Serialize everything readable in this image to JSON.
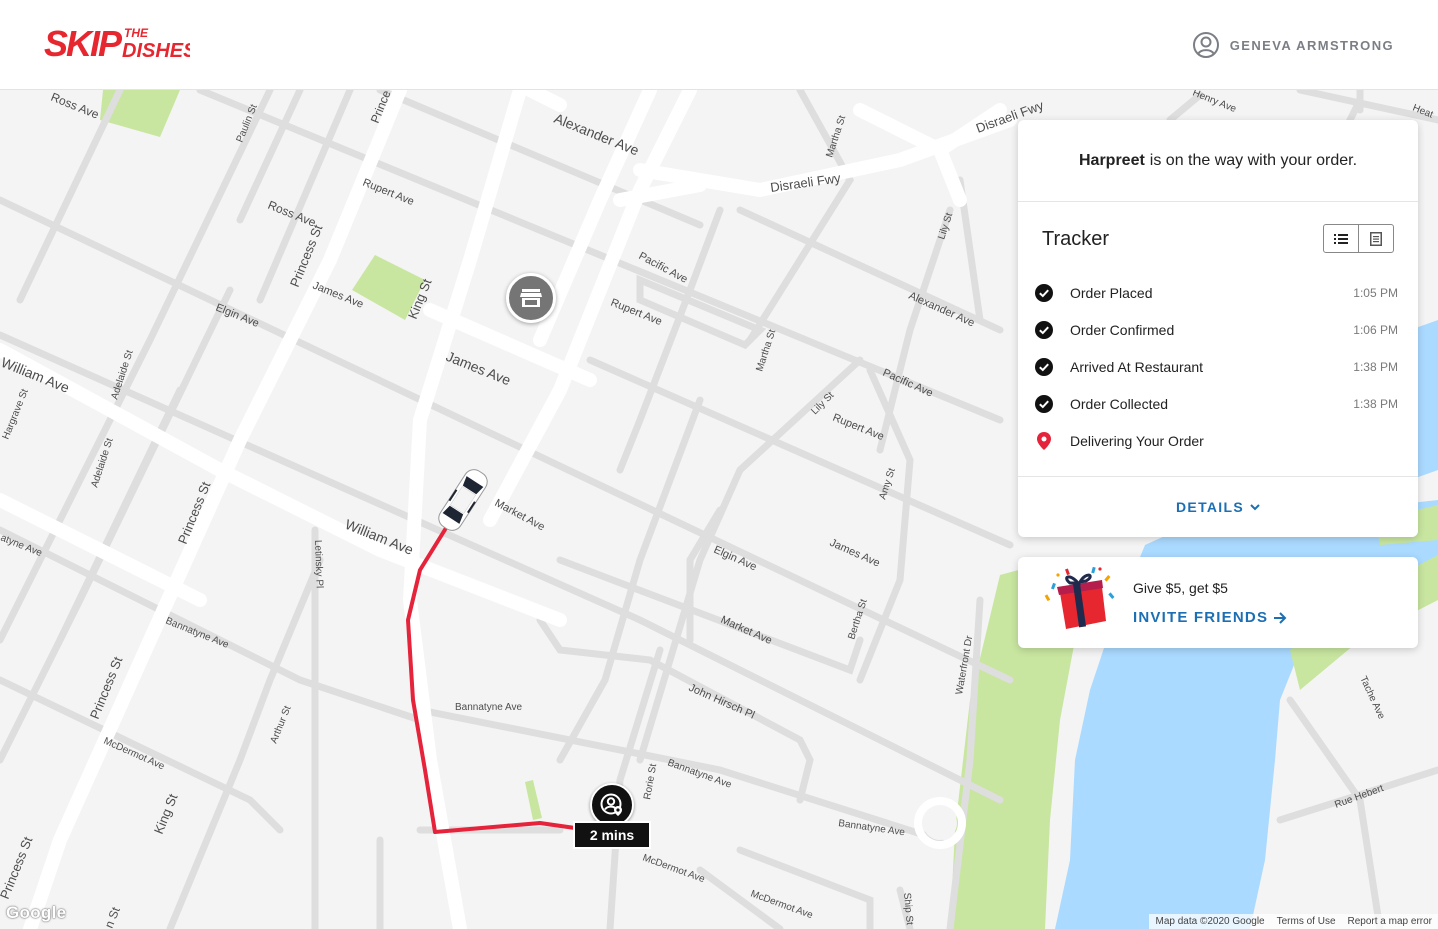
{
  "header": {
    "logo_text_top": "THE",
    "logo_text_main": "SKIP",
    "logo_text_sub": "DISHES",
    "user_name": "GENEVA ARMSTRONG",
    "user_icon": "user-circle-icon"
  },
  "colors": {
    "brand_red": "#e6272f",
    "link_blue": "#1d6fb3",
    "route_red": "#e5233a",
    "water": "#aadaff",
    "park": "#c8e6a0"
  },
  "tracker": {
    "driver_name": "Harpreet",
    "status_message": "is on the way with your order.",
    "title": "Tracker",
    "view_icons": [
      "list-icon",
      "receipt-icon"
    ],
    "steps": [
      {
        "label": "Order Placed",
        "time": "1:05 PM",
        "icon": "check-circle-icon"
      },
      {
        "label": "Order Confirmed",
        "time": "1:06 PM",
        "icon": "check-circle-icon"
      },
      {
        "label": "Arrived At Restaurant",
        "time": "1:38 PM",
        "icon": "check-circle-icon"
      },
      {
        "label": "Order Collected",
        "time": "1:38 PM",
        "icon": "check-circle-icon"
      },
      {
        "label": "Delivering Your Order",
        "time": "",
        "icon": "location-pin-icon"
      }
    ],
    "details_label": "DETAILS"
  },
  "referral": {
    "text": "Give $5, get $5",
    "link_label": "INVITE FRIENDS"
  },
  "map": {
    "eta": "2 mins",
    "google_logo": "Google",
    "attribution": [
      "Map data ©2020 Google",
      "Terms of Use",
      "Report a map error"
    ],
    "streets": {
      "ross_ave_1": "Ross Ave",
      "ross_ave_2": "Ross Ave",
      "paulin_st": "Paulin St",
      "princess_top": "Prince",
      "alexander_ave_1": "Alexander Ave",
      "martha_st_1": "Martha St",
      "disraeli_fwy_1": "Disraeli Fwy",
      "disraeli_fwy_2": "Disraeli Fwy",
      "henry_ave": "Henry Ave",
      "heath": "Heat",
      "rupert_ave_1": "Rupert Ave",
      "princess_st_1": "Princess St",
      "james_ave_1": "James Ave",
      "king_st_1": "King St",
      "elgin_ave_1": "Elgin Ave",
      "pacific_ave_1": "Pacific Ave",
      "rupert_ave_2": "Rupert Ave",
      "lily_st_1": "Lily St",
      "alexander_ave_2": "Alexander Ave",
      "martha_st_2": "Martha St",
      "pacific_ave_2": "Pacific Ave",
      "william_ave_1": "William Ave",
      "hargrave_st": "Hargrave St",
      "adelaide_st_1": "Adelaide St",
      "james_ave_2": "James Ave",
      "lily_st_2": "Lily St",
      "rupert_ave_3": "Rupert Ave",
      "adelaide_st_2": "Adelaide St",
      "amy_st": "Amy St",
      "princess_st_2": "Princess St",
      "market_ave_1": "Market Ave",
      "william_ave_2": "William Ave",
      "elgin_ave_2": "Elgin Ave",
      "james_ave_3": "James Ave",
      "letinsky_pl": "Letinsky Pl",
      "atyne_ave": "atyne Ave",
      "bertha_st": "Bertha St",
      "market_ave_2": "Market Ave",
      "bannatyne_ave_1": "Bannatyne Ave",
      "waterfront_dr": "Waterfront Dr",
      "princess_st_3": "Princess St",
      "john_hirsch_pl": "John Hirsch Pl",
      "bannatyne_ave_2": "Bannatyne Ave",
      "arthur_st": "Arthur St",
      "tache_ave": "Tache Ave",
      "mcdermot_ave_1": "McDermot Ave",
      "bannatyne_ave_3": "Bannatyne Ave",
      "rorie_st": "Rorie St",
      "king_st_2": "King St",
      "rue_hebert": "Rue Hebert",
      "bannatyne_ave_4": "Bannatyne Ave",
      "mcdermot_ave_2": "McDermot Ave",
      "princess_st_4": "Princess St",
      "mcdermot_ave_3": "McDermot Ave",
      "ship_st": "Ship St",
      "st_bottom": "n St"
    }
  }
}
